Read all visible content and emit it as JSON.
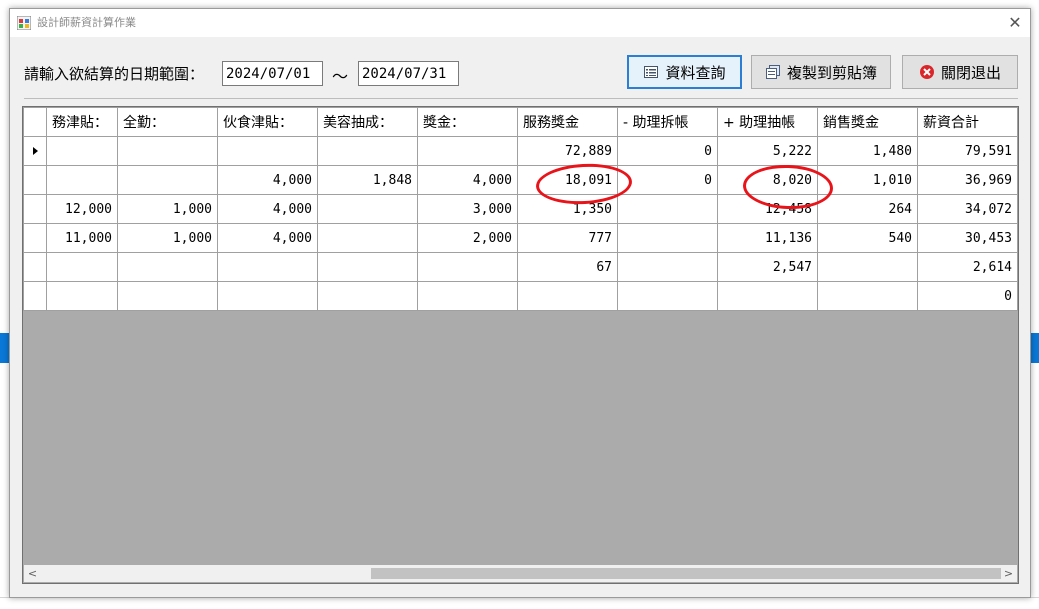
{
  "window": {
    "title": "設計師薪資計算作業",
    "close_symbol": "✕"
  },
  "filter": {
    "range_label": "請輸入欲結算的日期範圍：",
    "date_from": "2024/07/01",
    "separator": "～",
    "date_to": "2024/07/31"
  },
  "toolbar": {
    "query_label": "資料查詢",
    "copy_label": "複製到剪貼簿",
    "exit_label": "關閉退出"
  },
  "grid": {
    "columns": [
      "務津貼：",
      "全勤：",
      "伙食津貼：",
      "美容抽成：",
      "獎金：",
      "服務獎金",
      "- 助理拆帳",
      "+ 助理抽帳",
      "銷售獎金",
      "薪資合計"
    ],
    "rows": [
      [
        "",
        "",
        "",
        "",
        "",
        "72,889",
        "0",
        "5,222",
        "1,480",
        "79,591"
      ],
      [
        "",
        "",
        "4,000",
        "1,848",
        "4,000",
        "18,091",
        "0",
        "8,020",
        "1,010",
        "36,969"
      ],
      [
        "12,000",
        "1,000",
        "4,000",
        "",
        "3,000",
        "1,350",
        "",
        "12,458",
        "264",
        "34,072"
      ],
      [
        "11,000",
        "1,000",
        "4,000",
        "",
        "2,000",
        "777",
        "",
        "11,136",
        "540",
        "30,453"
      ],
      [
        "",
        "",
        "",
        "",
        "",
        "67",
        "",
        "2,547",
        "",
        "2,614"
      ],
      [
        "",
        "",
        "",
        "",
        "",
        "",
        "",
        "",
        "",
        "0"
      ]
    ],
    "current_row_index": 0,
    "scroll_left_symbol": "<",
    "scroll_right_symbol": ">"
  },
  "annotations": {
    "color": "#e8141a",
    "circled_values": [
      "18,091",
      "8,020"
    ]
  }
}
